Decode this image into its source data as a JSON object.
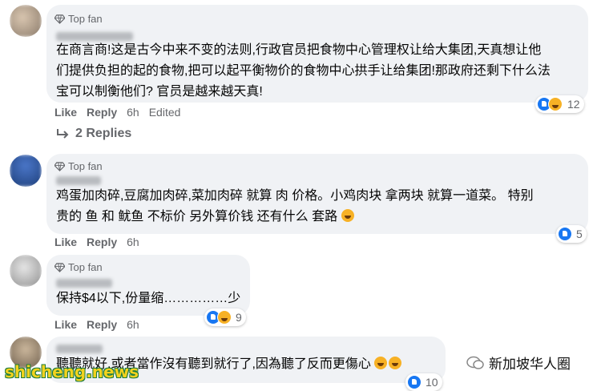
{
  "comments": [
    {
      "badge": "Top fan",
      "text_lines": [
        "在商言商!这是古今中来不变的法则,行政官员把食物中心管理权让给大集团,天真想让他",
        "们提供负担的起的食物,把可以起平衡物价的食物中心拱手让给集团!那政府还剩下什么法",
        "宝可以制衡他们? 官员是越来越天真!"
      ],
      "like": "Like",
      "reply": "Reply",
      "time": "6h",
      "edited": "Edited",
      "reaction_count": "12",
      "replies_label": "2 Replies"
    },
    {
      "badge": "Top fan",
      "text_lines": [
        "鸡蛋加肉碎,豆腐加肉碎,菜加肉碎 就算 肉 价格。小鸡肉块 拿两块 就算一道菜。 特别",
        "贵的 鱼 和 鱿鱼 不标价 另外算价钱 还有什么 套路"
      ],
      "like": "Like",
      "reply": "Reply",
      "time": "6h",
      "reaction_count": "5"
    },
    {
      "badge": "Top fan",
      "text_lines": [
        "保持$4以下,份量缩……………少"
      ],
      "like": "Like",
      "reply": "Reply",
      "time": "6h",
      "reaction_count": "9"
    },
    {
      "text_lines": [
        "聽聽就好,或者當作沒有聽到就行了,因為聽了反而更傷心"
      ],
      "reaction_count": "10"
    }
  ],
  "watermark": {
    "site": "shicheng.news",
    "channel": "新加坡华人圈"
  },
  "colors": {
    "bubble": "#f0f2f5",
    "like_blue": "#1877f2",
    "haha_yellow": "#f7b125",
    "secondary_text": "#65676b"
  }
}
